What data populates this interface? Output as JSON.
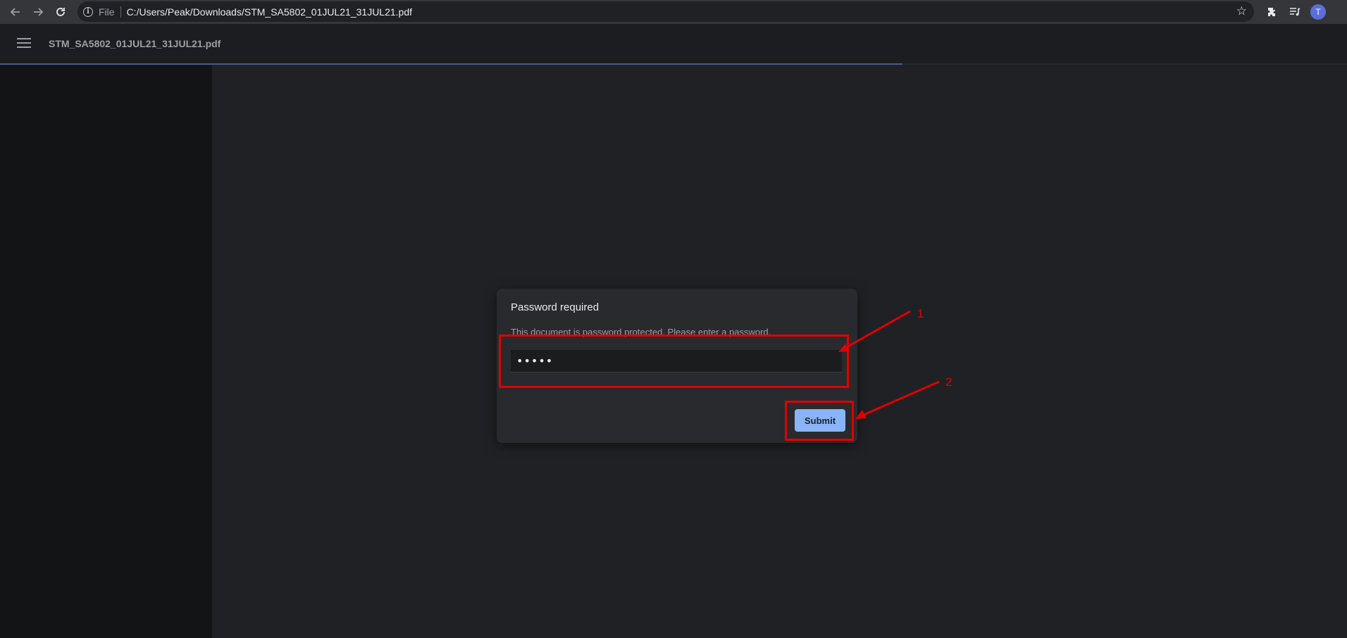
{
  "browser": {
    "scheme_label": "File",
    "url": "C:/Users/Peak/Downloads/STM_SA5802_01JUL21_31JUL21.pdf",
    "profile_initial": "T",
    "accent_color": "#5b6fd6"
  },
  "pdf_viewer": {
    "file_title": "STM_SA5802_01JUL21_31JUL21.pdf",
    "load_progress": 0.67
  },
  "dialog": {
    "title": "Password required",
    "message": "This document is password protected. Please enter a password.",
    "password_value": "•••••",
    "submit_label": "Submit",
    "submit_color": "#8ab4f8"
  },
  "annotations": {
    "color": "#e00000",
    "labels": [
      "1",
      "2"
    ]
  },
  "icons": [
    "back-arrow-icon",
    "forward-arrow-icon",
    "reload-icon",
    "info-icon",
    "star-icon",
    "extensions-icon",
    "media-control-icon",
    "menu-icon"
  ]
}
